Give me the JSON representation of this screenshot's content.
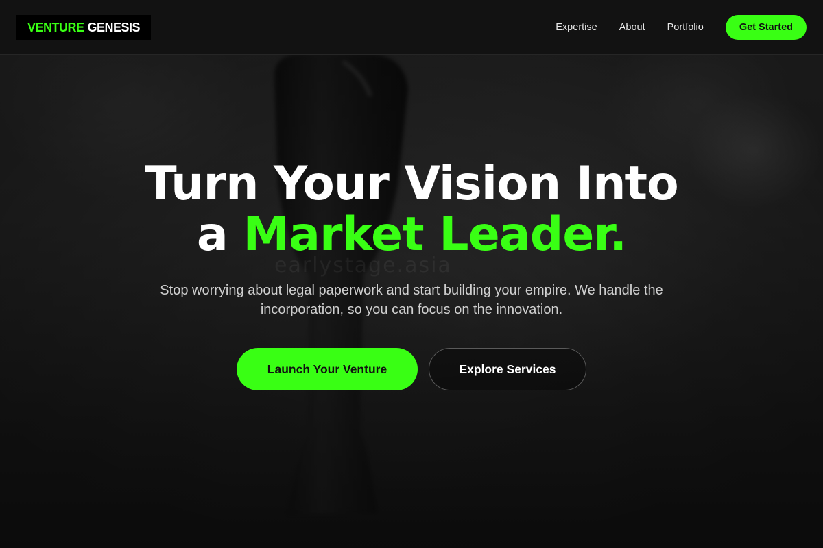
{
  "brand": {
    "name_part1": "VENTURE",
    "name_part2": "GENESIS",
    "accent_color": "#39ff14"
  },
  "nav": {
    "links": [
      "Expertise",
      "About",
      "Portfolio"
    ],
    "cta_label": "Get Started"
  },
  "hero": {
    "title_line1": "Turn Your Vision Into",
    "title_line2_prefix": "a ",
    "title_line2_accent": "Market Leader.",
    "subtitle": "Stop worrying about legal paperwork and start building your empire. We handle the incorporation, so you can focus on the innovation.",
    "primary_button": "Launch Your Venture",
    "secondary_button": "Explore Services",
    "watermark": "earlystage.asia"
  }
}
